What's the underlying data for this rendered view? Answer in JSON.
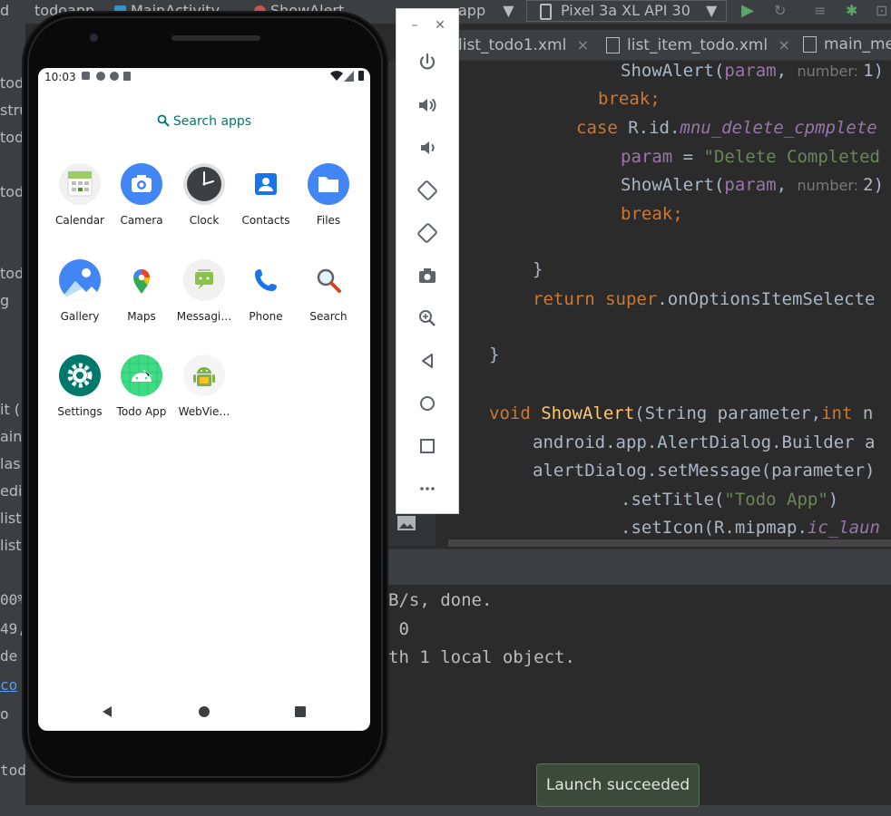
{
  "ide": {
    "breadcrumbs": [
      "d",
      "todoapp",
      "MainActivity",
      "ShowAlert"
    ],
    "run_config": "app",
    "device": "Pixel 3a XL API 30",
    "tabs": [
      {
        "label": "list_todo1.xml"
      },
      {
        "label": "list_item_todo.xml"
      },
      {
        "label": "main_me"
      }
    ],
    "left_sliver_texts": [
      "tod",
      "stru",
      "tod",
      "tod",
      "tod",
      "g",
      "it (",
      "ain",
      "lasl",
      "edi",
      "list",
      "list"
    ],
    "code_lines": [
      {
        "segments": [
          {
            "t": "ShowAlert(",
            "c": "plain"
          },
          {
            "t": "param",
            "c": "var"
          },
          {
            "t": ", ",
            "c": "plain"
          },
          {
            "t": "number: ",
            "c": "hint"
          },
          {
            "t": "1)",
            "c": "plain"
          }
        ]
      },
      {
        "segments": [
          {
            "t": "break;",
            "c": "kw"
          }
        ]
      },
      {
        "segments": [
          {
            "t": "case ",
            "c": "kw"
          },
          {
            "t": "R.id.",
            "c": "plain"
          },
          {
            "t": "mnu_delete_cpmplete",
            "c": "it"
          }
        ]
      },
      {
        "segments": [
          {
            "t": "param",
            "c": "var"
          },
          {
            "t": " = ",
            "c": "plain"
          },
          {
            "t": "\"Delete Completed",
            "c": "str"
          }
        ]
      },
      {
        "segments": [
          {
            "t": "ShowAlert(",
            "c": "plain"
          },
          {
            "t": "param",
            "c": "var"
          },
          {
            "t": ", ",
            "c": "plain"
          },
          {
            "t": "number: ",
            "c": "hint"
          },
          {
            "t": "2)",
            "c": "plain"
          }
        ]
      },
      {
        "segments": [
          {
            "t": "break;",
            "c": "kw"
          }
        ]
      },
      {
        "segments": [
          {
            "t": "}",
            "c": "plain"
          }
        ]
      },
      {
        "segments": [
          {
            "t": "return ",
            "c": "kw"
          },
          {
            "t": "super",
            "c": "kw"
          },
          {
            "t": ".onOptionsItemSelecte",
            "c": "plain"
          }
        ]
      },
      {
        "segments": [
          {
            "t": "}",
            "c": "plain"
          }
        ]
      },
      {
        "segments": [
          {
            "t": "void ",
            "c": "kw"
          },
          {
            "t": "ShowAlert",
            "c": "fn"
          },
          {
            "t": "(String parameter,",
            "c": "plain"
          },
          {
            "t": "int ",
            "c": "kw"
          },
          {
            "t": "n",
            "c": "plain"
          }
        ]
      },
      {
        "segments": [
          {
            "t": "android.app.AlertDialog.Builder a",
            "c": "plain"
          }
        ]
      },
      {
        "segments": [
          {
            "t": "alertDialog.setMessage(parameter)",
            "c": "plain"
          }
        ]
      },
      {
        "segments": [
          {
            "t": ".setTitle(",
            "c": "plain"
          },
          {
            "t": "\"Todo App\"",
            "c": "str"
          },
          {
            "t": ")",
            "c": "plain"
          }
        ]
      },
      {
        "segments": [
          {
            "t": ".setIcon(R.mipmap.",
            "c": "plain"
          },
          {
            "t": "ic_laun",
            "c": "it"
          }
        ]
      }
    ],
    "console_lines": [
      "B/s, done.",
      " 0",
      "th 1 local object."
    ],
    "left_console_texts": [
      "00%",
      "49,",
      "de",
      "co",
      "o",
      "todo"
    ],
    "toast": "Launch succeeded"
  },
  "phone": {
    "time": "10:03",
    "search_label": "Search apps",
    "apps": [
      {
        "label": "Calendar",
        "icon": "calendar-icon"
      },
      {
        "label": "Camera",
        "icon": "camera-icon"
      },
      {
        "label": "Clock",
        "icon": "clock-icon"
      },
      {
        "label": "Contacts",
        "icon": "contacts-icon"
      },
      {
        "label": "Files",
        "icon": "files-icon"
      },
      {
        "label": "Gallery",
        "icon": "gallery-icon"
      },
      {
        "label": "Maps",
        "icon": "maps-icon"
      },
      {
        "label": "Messagi…",
        "icon": "messaging-icon"
      },
      {
        "label": "Phone",
        "icon": "phone-icon"
      },
      {
        "label": "Search",
        "icon": "search-icon"
      },
      {
        "label": "Settings",
        "icon": "settings-icon"
      },
      {
        "label": "Todo App",
        "icon": "todo-app-icon"
      },
      {
        "label": "WebVie…",
        "icon": "webview-icon"
      }
    ]
  },
  "emulator_toolbar": [
    {
      "name": "power-icon"
    },
    {
      "name": "volume-up-icon"
    },
    {
      "name": "volume-down-icon"
    },
    {
      "name": "rotate-left-icon"
    },
    {
      "name": "rotate-right-icon"
    },
    {
      "name": "screenshot-icon"
    },
    {
      "name": "zoom-icon"
    },
    {
      "name": "back-icon"
    },
    {
      "name": "home-icon"
    },
    {
      "name": "overview-icon"
    },
    {
      "name": "more-icon"
    }
  ],
  "colors": {
    "accent": "#00796b",
    "toast_bg": "#3b4a3a",
    "ide_bg": "#2b2b2b",
    "keyword": "#cc7832",
    "string": "#6a8759"
  }
}
